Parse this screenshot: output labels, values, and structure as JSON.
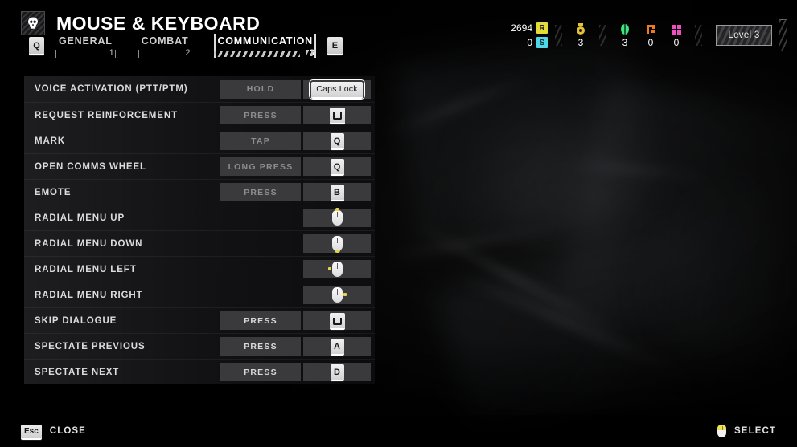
{
  "header": {
    "title": "MOUSE & KEYBOARD",
    "logo_icon": "skull-icon",
    "prev_tab_key": "Q",
    "next_tab_key": "E",
    "tabs": [
      {
        "label": "GENERAL",
        "number": "1",
        "active": false
      },
      {
        "label": "COMBAT",
        "number": "2",
        "active": false
      },
      {
        "label": "COMMUNICATION",
        "number": "3",
        "active": true
      }
    ]
  },
  "hud": {
    "currency": [
      {
        "value": "2694",
        "icon_letter": "R",
        "icon_name": "requisition-icon",
        "bg": "#e3dc3a",
        "fg": "#1a1a14"
      },
      {
        "value": "0",
        "icon_letter": "S",
        "icon_name": "samples-icon",
        "bg": "#4fd8e8",
        "fg": "#10282c"
      }
    ],
    "resources": [
      {
        "value": "3",
        "icon_name": "medal-icon",
        "color": "#e3c23a"
      },
      {
        "value": "3",
        "icon_name": "capsule-icon",
        "color": "#3ee87f"
      },
      {
        "value": "0",
        "icon_name": "orange-module-icon",
        "color": "#f07a1e"
      },
      {
        "value": "0",
        "icon_name": "pink-grid-icon",
        "color": "#ef4fc0"
      }
    ],
    "level_badge": "Level 3"
  },
  "settings": {
    "columns": [
      "action",
      "trigger",
      "binding"
    ],
    "rows": [
      {
        "label": "VOICE ACTIVATION (PTT/PTM)",
        "mode": "HOLD",
        "mode_bright": false,
        "key": "Caps Lock",
        "key_type": "wide",
        "selected": true
      },
      {
        "label": "REQUEST REINFORCEMENT",
        "mode": "PRESS",
        "mode_bright": false,
        "key": "",
        "key_type": "enter",
        "selected": false
      },
      {
        "label": "MARK",
        "mode": "TAP",
        "mode_bright": false,
        "key": "Q",
        "key_type": "key",
        "selected": false
      },
      {
        "label": "OPEN COMMS WHEEL",
        "mode": "LONG PRESS",
        "mode_bright": false,
        "key": "Q",
        "key_type": "key",
        "selected": false
      },
      {
        "label": "EMOTE",
        "mode": "PRESS",
        "mode_bright": false,
        "key": "B",
        "key_type": "key",
        "selected": false
      },
      {
        "label": "RADIAL MENU UP",
        "mode": "",
        "mode_bright": false,
        "key": "",
        "key_type": "mouse-up",
        "selected": false
      },
      {
        "label": "RADIAL MENU DOWN",
        "mode": "",
        "mode_bright": false,
        "key": "",
        "key_type": "mouse-down",
        "selected": false
      },
      {
        "label": "RADIAL MENU LEFT",
        "mode": "",
        "mode_bright": false,
        "key": "",
        "key_type": "mouse-left",
        "selected": false
      },
      {
        "label": "RADIAL MENU RIGHT",
        "mode": "",
        "mode_bright": false,
        "key": "",
        "key_type": "mouse-right",
        "selected": false
      },
      {
        "label": "SKIP DIALOGUE",
        "mode": "PRESS",
        "mode_bright": true,
        "key": "",
        "key_type": "enter",
        "selected": false
      },
      {
        "label": "SPECTATE PREVIOUS",
        "mode": "PRESS",
        "mode_bright": true,
        "key": "A",
        "key_type": "key",
        "selected": false
      },
      {
        "label": "SPECTATE NEXT",
        "mode": "PRESS",
        "mode_bright": true,
        "key": "D",
        "key_type": "key",
        "selected": false
      }
    ]
  },
  "footer": {
    "close_key": "Esc",
    "close_label": "CLOSE",
    "select_icon": "mouse-icon",
    "select_label": "SELECT"
  }
}
